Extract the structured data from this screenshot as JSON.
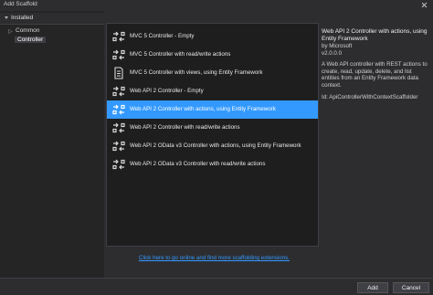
{
  "window": {
    "title": "Add Scaffold",
    "close_icon": "close-icon"
  },
  "nav": {
    "header": "Installed",
    "items": [
      {
        "label": "Common",
        "icon": "chevron-right-icon"
      },
      {
        "label": "Controller",
        "selected": true
      }
    ]
  },
  "list": {
    "items": [
      {
        "label": "MVC 5 Controller - Empty",
        "icon": "controller-icon"
      },
      {
        "label": "MVC 5 Controller with read/write actions",
        "icon": "controller-icon"
      },
      {
        "label": "MVC 5 Controller with views, using Entity Framework",
        "icon": "controller-views-icon"
      },
      {
        "label": "Web API 2 Controller - Empty",
        "icon": "controller-icon"
      },
      {
        "label": "Web API 2 Controller with actions, using Entity Framework",
        "icon": "controller-icon",
        "selected": true
      },
      {
        "label": "Web API 2 Controller with read/write actions",
        "icon": "controller-icon"
      },
      {
        "label": "Web API 2 OData v3 Controller with actions, using Entity Framework",
        "icon": "controller-icon"
      },
      {
        "label": "Web API 2 OData v3 Controller with read/write actions",
        "icon": "controller-icon"
      }
    ]
  },
  "details": {
    "title": "Web API 2 Controller with actions, using Entity Framework",
    "author": "by Microsoft",
    "version": "v2.0.0.0",
    "description": "A Web API controller with REST actions to create, read, update, delete, and list entities from an Entity Framework data context.",
    "id": "Id: ApiControllerWithContextScaffolder"
  },
  "link": "Click here to go online and find more scaffolding extensions.",
  "buttons": {
    "add": "Add",
    "cancel": "Cancel"
  },
  "colors": {
    "accent": "#3399ff",
    "background": "#2d2d30",
    "list_background": "#1e1e1e"
  }
}
